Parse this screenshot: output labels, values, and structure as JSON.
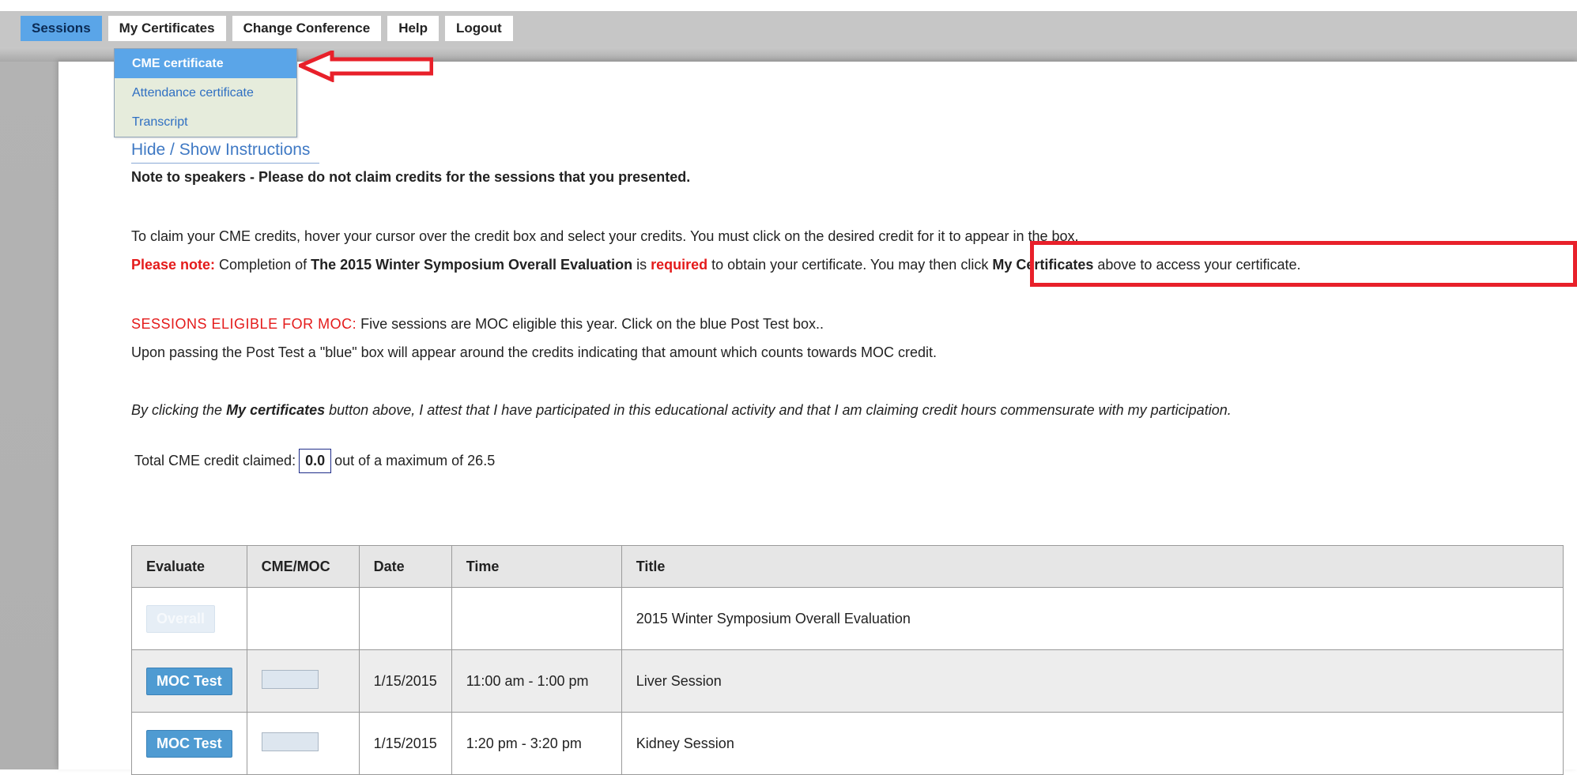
{
  "nav": {
    "items": [
      "Sessions",
      "My Certificates",
      "Change Conference",
      "Help",
      "Logout"
    ]
  },
  "dropdown": {
    "items": [
      "CME certificate",
      "Attendance certificate",
      "Transcript"
    ]
  },
  "instructions_toggle": "Hide / Show Instructions",
  "note_speakers": "Note to speakers - Please do not claim credits for the sessions that you presented.",
  "claim_line": "To claim your CME credits, hover your cursor over the credit box and select your credits. You must click on the desired credit for it to appear in the box.",
  "please_note": {
    "label": "Please note:",
    "part1": " Completion of ",
    "eval_name": "The 2015 Winter Symposium Overall Evaluation",
    "part2": " is ",
    "required": "required",
    "part3": " to obtain your certificate. ",
    "part4": "You may then click ",
    "my_certs": "My Certificates",
    "part5": " above to access your certificate."
  },
  "moc": {
    "label": "SESSIONS ELIGIBLE FOR MOC:",
    "text": " Five sessions are MOC eligible this year. Click on the blue Post Test box..",
    "line2": "Upon passing the Post Test a \"blue\" box will appear around the credits indicating that amount which counts towards MOC credit."
  },
  "attest": {
    "part1": "By clicking the ",
    "bold": "My certificates",
    "part2": " button above, I attest that I have participated in this educational activity and that I am claiming credit hours commensurate with my participation."
  },
  "total": {
    "label": "Total CME credit claimed:",
    "value": "0.0",
    "suffix": "out of a maximum of 26.5"
  },
  "table": {
    "headers": [
      "Evaluate",
      "CME/MOC",
      "Date",
      "Time",
      "Title"
    ],
    "rows": [
      {
        "button": "Overall",
        "date": "",
        "time": "",
        "title": "2015 Winter Symposium Overall Evaluation"
      },
      {
        "button": "MOC Test",
        "date": "1/15/2015",
        "time": "11:00 am - 1:00 pm",
        "title": "Liver Session"
      },
      {
        "button": "MOC Test",
        "date": "1/15/2015",
        "time": "1:20 pm - 3:20 pm",
        "title": "Kidney Session"
      }
    ]
  },
  "colors": {
    "nav_active": "#5aa5e8",
    "link": "#3f79c4",
    "alert_red": "#e41b1b",
    "button_blue": "#4f9bd2"
  }
}
